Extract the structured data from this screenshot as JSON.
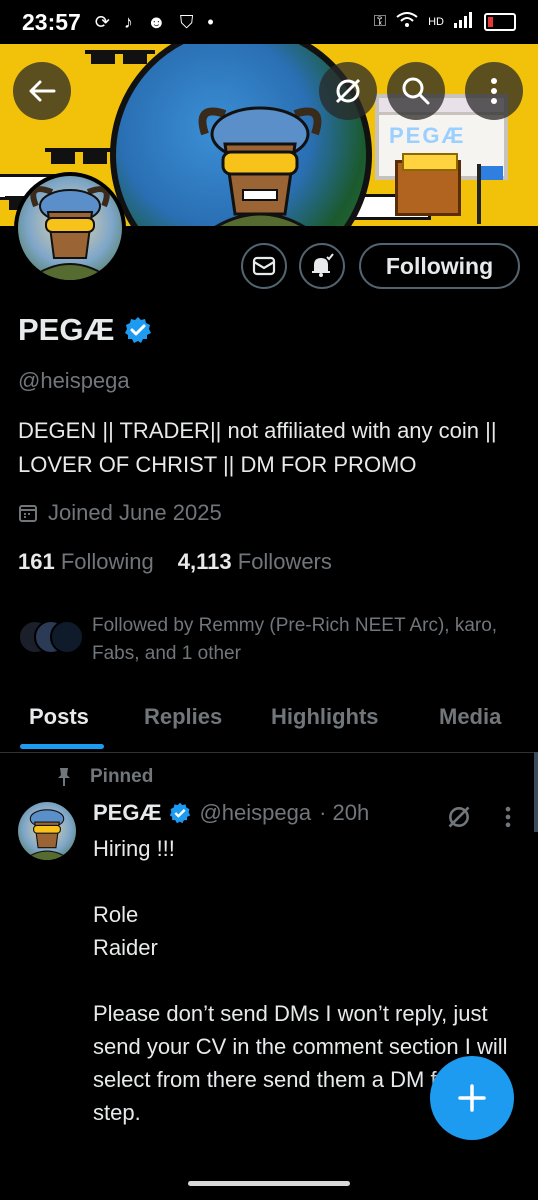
{
  "status_bar": {
    "time": "23:57",
    "network": "HD",
    "battery_icon": "battery-low-icon"
  },
  "banner": {
    "window_text": "PEGÆ",
    "background_color": "#f2c20a"
  },
  "profile": {
    "display_name": "PEGÆ",
    "handle": "@heispega",
    "verified_color": "#1d9bf0",
    "bio": "DEGEN || TRADER|| not affiliated with any coin || LOVER OF CHRIST || DM FOR PROMO",
    "joined": "Joined June 2025",
    "following_count": "161",
    "following_label": "Following",
    "followers_count": "4,113",
    "followers_label": "Followers",
    "followed_by": "Followed by Remmy (Pre-Rich NEET Arc), karo, Fabs, and 1 other"
  },
  "actions": {
    "following_button": "Following"
  },
  "tabs": [
    {
      "label": "Posts",
      "active": true
    },
    {
      "label": "Replies",
      "active": false
    },
    {
      "label": "Highlights",
      "active": false
    },
    {
      "label": "Media",
      "active": false
    }
  ],
  "pinned_post": {
    "pinned_label": "Pinned",
    "author_name": "PEGÆ",
    "author_handle": "@heispega",
    "time": "· 20h",
    "body": "Hiring !!!\n\nRole\nRaider\n\nPlease don’t send DMs I won’t reply, just send your CV in the comment section  I will select from there send them a DM for next step."
  },
  "colors": {
    "accent": "#1d9bf0",
    "background": "#000000",
    "muted_text": "#71767b"
  }
}
